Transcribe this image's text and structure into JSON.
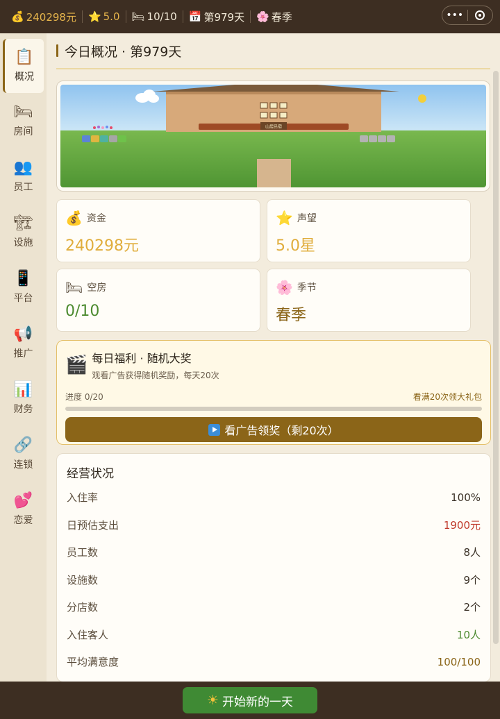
{
  "topbar": {
    "money": "240298元",
    "rating": "5.0",
    "rooms": "10/10",
    "day": "第979天",
    "season": "春季",
    "icons": {
      "money": "money-bag-icon",
      "rating": "star-icon",
      "rooms": "bed-icon",
      "day": "calendar-icon",
      "season": "cherry-blossom-icon"
    }
  },
  "sidebar": {
    "items": [
      {
        "label": "概况",
        "icon": "clipboard-icon",
        "glyph": "📋"
      },
      {
        "label": "房间",
        "icon": "bed-icon",
        "glyph": "🛏"
      },
      {
        "label": "员工",
        "icon": "people-icon",
        "glyph": "👥"
      },
      {
        "label": "设施",
        "icon": "crane-icon",
        "glyph": "🏗"
      },
      {
        "label": "平台",
        "icon": "phone-icon",
        "glyph": "📱"
      },
      {
        "label": "推广",
        "icon": "megaphone-icon",
        "glyph": "📢"
      },
      {
        "label": "财务",
        "icon": "bar-chart-icon",
        "glyph": "📊"
      },
      {
        "label": "连锁",
        "icon": "link-icon",
        "glyph": "🔗"
      },
      {
        "label": "恋爱",
        "icon": "hearts-icon",
        "glyph": "💕"
      }
    ]
  },
  "page": {
    "title": "今日概况 · 第979天"
  },
  "scene": {
    "sign": "山居民宿"
  },
  "stats": {
    "money": {
      "label": "资金",
      "value": "240298元",
      "icon": "money-bag-icon"
    },
    "rating": {
      "label": "声望",
      "value": "5.0星",
      "icon": "star-icon"
    },
    "rooms": {
      "label": "空房",
      "value": "0/10",
      "icon": "bed-icon"
    },
    "season": {
      "label": "季节",
      "value": "春季",
      "icon": "cherry-blossom-icon"
    }
  },
  "ad": {
    "title": "每日福利 · 随机大奖",
    "subtitle": "观看广告获得随机奖励，每天20次",
    "progress_label": "进度 0/20",
    "progress_value": 0,
    "reward_hint": "看满20次领大礼包",
    "button_label": "看广告领奖（剩20次）"
  },
  "ops": {
    "title": "经营状况",
    "rows": [
      {
        "label": "入住率",
        "value": "100%",
        "color": "#3a3025"
      },
      {
        "label": "日预估支出",
        "value": "1900元",
        "color": "#c0392b"
      },
      {
        "label": "员工数",
        "value": "8人",
        "color": "#3a3025"
      },
      {
        "label": "设施数",
        "value": "9个",
        "color": "#3a3025"
      },
      {
        "label": "分店数",
        "value": "2个",
        "color": "#3a3025"
      },
      {
        "label": "入住客人",
        "value": "10人",
        "color": "#4c8a2f"
      },
      {
        "label": "平均满意度",
        "value": "100/100",
        "color": "#8b6518"
      }
    ]
  },
  "bottom": {
    "start_label": "开始新的一天"
  },
  "colors": {
    "accent": "#8b6518",
    "topbar": "#3d2e22",
    "start": "#3f8a34",
    "gold": "#e0ad3c"
  }
}
